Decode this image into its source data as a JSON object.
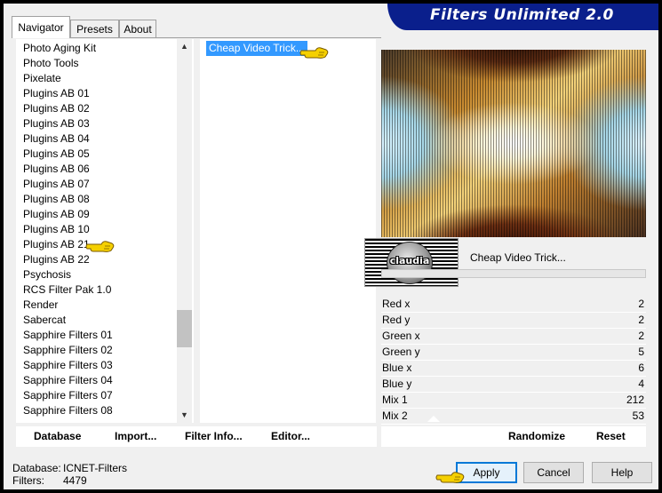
{
  "window": {
    "title": "Filters Unlimited 2.0"
  },
  "tabs": [
    {
      "label": "Navigator",
      "active": true
    },
    {
      "label": "Presets",
      "active": false
    },
    {
      "label": "About",
      "active": false
    }
  ],
  "categories": {
    "items": [
      "Photo Aging Kit",
      "Photo Tools",
      "Pixelate",
      "Plugins AB 01",
      "Plugins AB 02",
      "Plugins AB 03",
      "Plugins AB 04",
      "Plugins AB 05",
      "Plugins AB 06",
      "Plugins AB 07",
      "Plugins AB 08",
      "Plugins AB 09",
      "Plugins AB 10",
      "Plugins AB 21",
      "Plugins AB 22",
      "Psychosis",
      "RCS Filter Pak 1.0",
      "Render",
      "Sabercat",
      "Sapphire Filters 01",
      "Sapphire Filters 02",
      "Sapphire Filters 03",
      "Sapphire Filters 04",
      "Sapphire Filters 07",
      "Sapphire Filters 08"
    ],
    "selected": "Plugins AB 21"
  },
  "filters": {
    "items": [
      "Cheap Video Trick..."
    ],
    "selected": "Cheap Video Trick..."
  },
  "preview": {
    "logo_text": "claudia",
    "filter_name": "Cheap Video Trick..."
  },
  "params": [
    {
      "label": "Red x",
      "value": "2"
    },
    {
      "label": "Red y",
      "value": "2"
    },
    {
      "label": "Green x",
      "value": "2"
    },
    {
      "label": "Green y",
      "value": "5"
    },
    {
      "label": "Blue x",
      "value": "6"
    },
    {
      "label": "Blue y",
      "value": "4"
    },
    {
      "label": "Mix 1",
      "value": "212"
    },
    {
      "label": "Mix 2",
      "value": "53"
    }
  ],
  "left_toolbar": {
    "database": "Database",
    "import": "Import...",
    "filter_info": "Filter Info...",
    "editor": "Editor..."
  },
  "right_toolbar": {
    "randomize": "Randomize",
    "reset": "Reset"
  },
  "status": {
    "database_label": "Database:",
    "database_value": "ICNET-Filters",
    "filters_label": "Filters:",
    "filters_value": "4479"
  },
  "buttons": {
    "apply": "Apply",
    "cancel": "Cancel",
    "help": "Help"
  },
  "colors": {
    "banner": "#0a1f8c",
    "selection": "#3399ff",
    "hand": "#f5d000"
  },
  "icons": {
    "pointer": "pointing-hand-icon"
  }
}
